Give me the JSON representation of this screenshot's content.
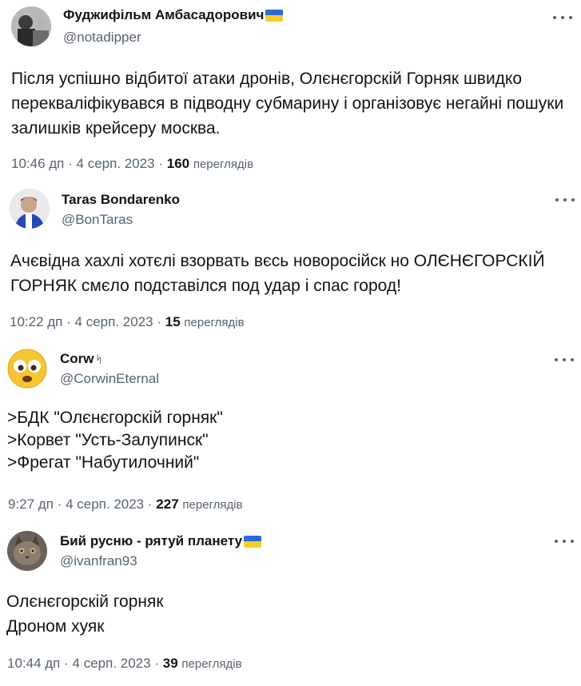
{
  "tweets": [
    {
      "name": "Фуджифільм Амбасадорович",
      "handle": "@notadipper",
      "text": "Після успішно відбитої атаки дронів, Олєнєгорскій Горняк швидко\nперекваліфікувався в підводну субмарину і організовує негайні пошуки\nзалишків крейсеру москва.",
      "time": "10:46 дп",
      "date": "4 серп. 2023",
      "views": "160",
      "views_label": "переглядів"
    },
    {
      "name": "Taras Bondarenko",
      "handle": "@BonTaras",
      "text": "Ачєвідна хахлі хотєлі взорвать вєсь новоросійск но ОЛЄНЄГОРСКІЙ\nГОРНЯК смєло подставілся под удар і спас город!",
      "time": "10:22 дп",
      "date": "4 серп. 2023",
      "views": "15",
      "views_label": "переглядів"
    },
    {
      "name": "Corw",
      "name_suffix": "ᛋ",
      "handle": "@CorwinEternal",
      "text": ">БДК \"Олєнєгорскій горняк\"\n>Корвет \"Усть-Залупинск\"\n>Фрегат \"Набутилочний\"",
      "time": "9:27 дп",
      "date": "4 серп. 2023",
      "views": "227",
      "views_label": "переглядів"
    },
    {
      "name": "Бий русню - рятуй планету",
      "handle": "@ivanfran93",
      "text": "Олєнєгорскій горняк\nДроном хуяк",
      "time": "10:44 дп",
      "date": "4 серп. 2023",
      "views": "39",
      "views_label": "переглядів"
    }
  ],
  "separator": "·",
  "colors": {
    "text": "#0f1419",
    "secondary": "#536471",
    "flag_blue": "#2d6ad9",
    "flag_yellow": "#f7cd2c"
  },
  "icons": {
    "more": "more-dots-icon",
    "flag": "ukraine-flag-icon"
  }
}
